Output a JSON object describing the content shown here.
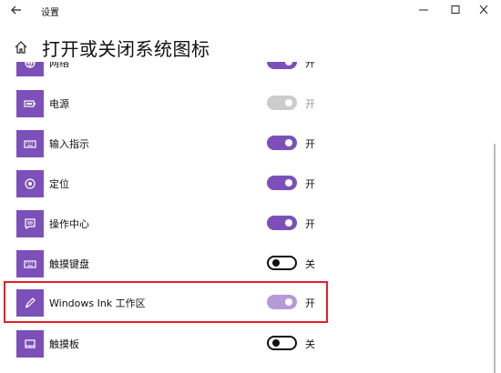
{
  "window": {
    "title": "设置"
  },
  "header": {
    "title": "打开或关闭系统图标"
  },
  "settings": [
    {
      "label": "网络",
      "state": "开",
      "toggle": "on",
      "icon": "network-icon"
    },
    {
      "label": "电源",
      "state": "开",
      "toggle": "disabled",
      "icon": "battery-icon"
    },
    {
      "label": "输入指示",
      "state": "开",
      "toggle": "on",
      "icon": "keyboard-icon"
    },
    {
      "label": "定位",
      "state": "开",
      "toggle": "on",
      "icon": "location-icon"
    },
    {
      "label": "操作中心",
      "state": "开",
      "toggle": "on",
      "icon": "action-center-icon"
    },
    {
      "label": "触摸键盘",
      "state": "关",
      "toggle": "off",
      "icon": "touch-keyboard-icon"
    },
    {
      "label": "Windows Ink 工作区",
      "state": "开",
      "toggle": "on-hover",
      "icon": "pen-icon"
    },
    {
      "label": "触摸板",
      "state": "关",
      "toggle": "off",
      "icon": "touchpad-icon"
    }
  ],
  "colors": {
    "accent": "#7c50b8",
    "highlight": "#e32026"
  }
}
